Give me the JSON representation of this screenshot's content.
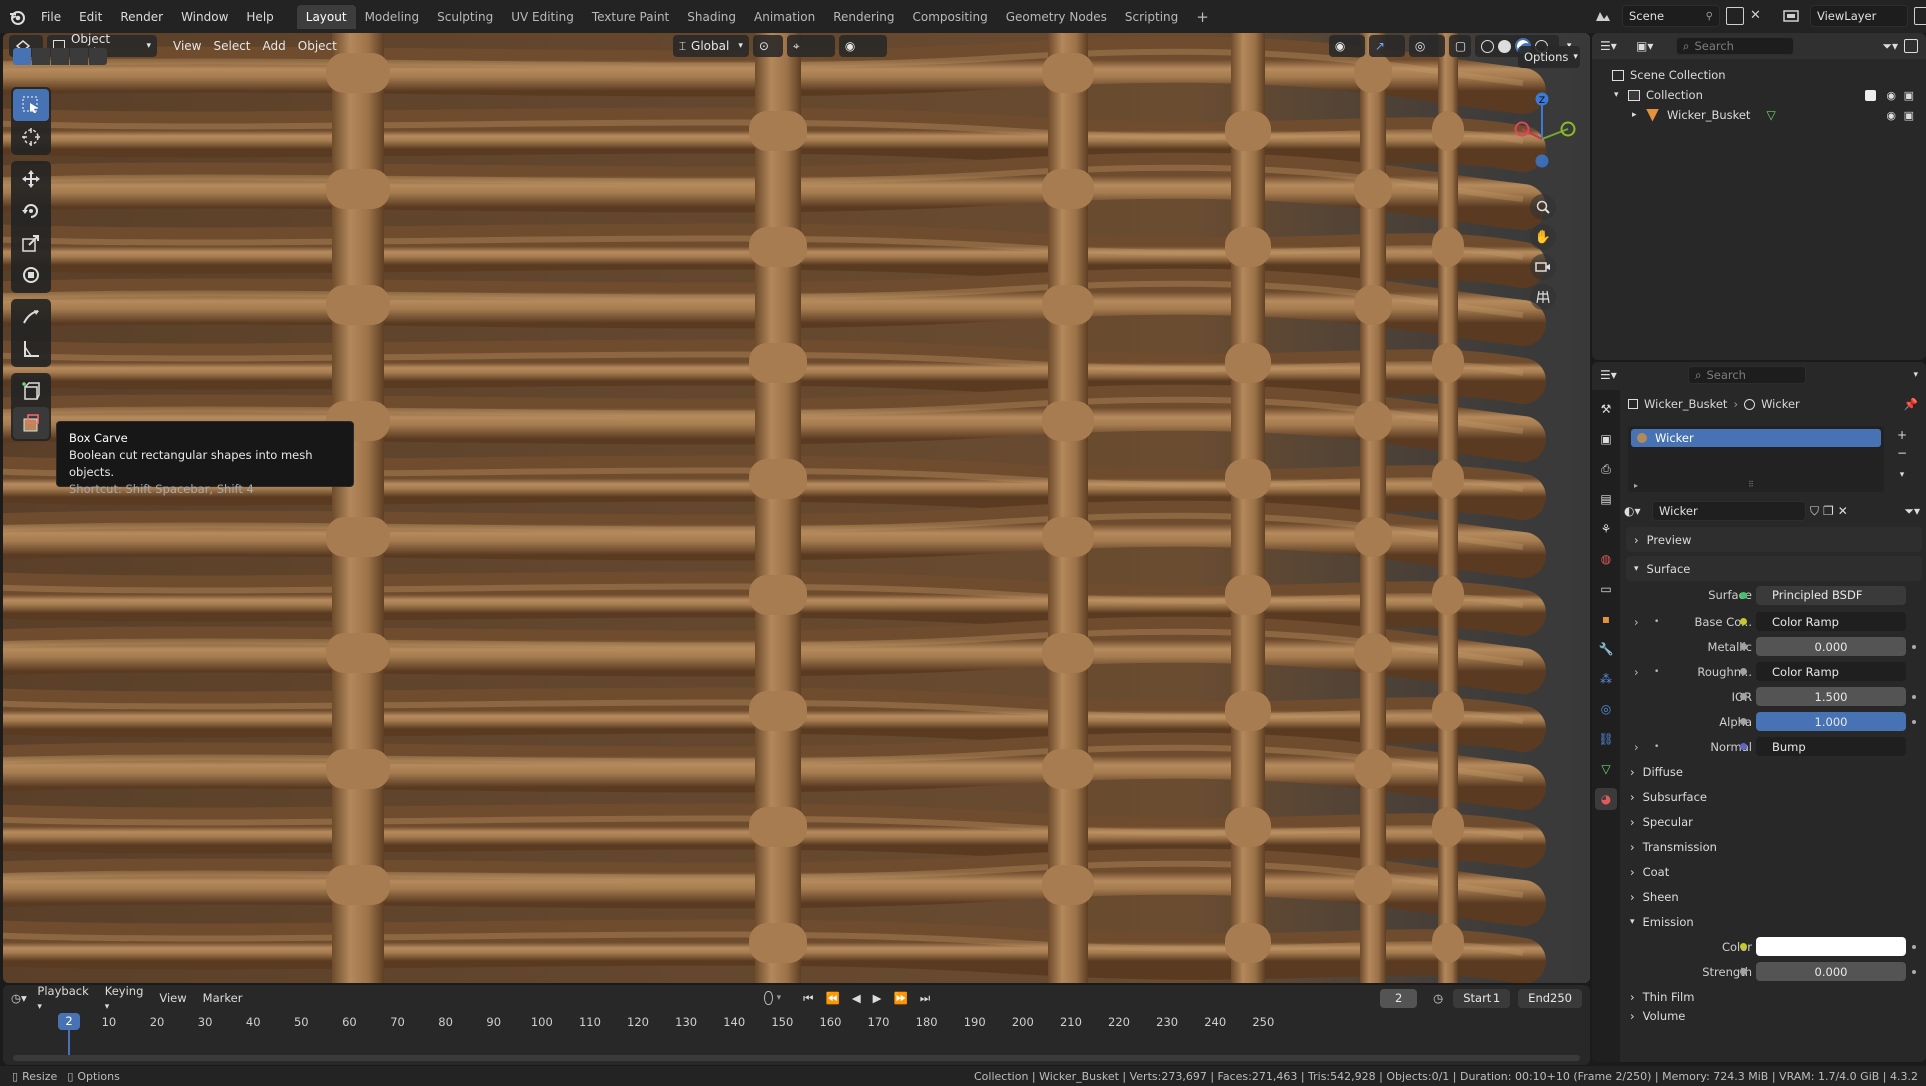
{
  "menu": [
    "File",
    "Edit",
    "Render",
    "Window",
    "Help"
  ],
  "workspaces": [
    "Layout",
    "Modeling",
    "Sculpting",
    "UV Editing",
    "Texture Paint",
    "Shading",
    "Animation",
    "Rendering",
    "Compositing",
    "Geometry Nodes",
    "Scripting"
  ],
  "active_workspace": "Layout",
  "scene": "Scene",
  "view_layer": "ViewLayer",
  "viewport": {
    "mode": "Object Mode",
    "menus": [
      "View",
      "Select",
      "Add",
      "Object"
    ],
    "orientation": "Global",
    "options_label": "Options",
    "gizmo_axes": {
      "z": "Z",
      "y": "Y",
      "x": "X"
    }
  },
  "tooltip": {
    "title": "Box Carve",
    "description": "Boolean cut rectangular shapes into mesh objects.",
    "shortcut": "Shortcut: Shift Spacebar, Shift 4"
  },
  "outliner": {
    "search_placeholder": "Search",
    "scene_collection": "Scene Collection",
    "collection": "Collection",
    "object": "Wicker_Busket"
  },
  "properties": {
    "search_placeholder": "Search",
    "breadcrumb_object": "Wicker_Busket",
    "breadcrumb_material": "Wicker",
    "slot_name": "Wicker",
    "material_name": "Wicker",
    "sections": {
      "preview": "Preview",
      "surface": "Surface"
    },
    "surface_shader_label": "Surface",
    "surface_shader": "Principled BSDF",
    "rows": [
      {
        "label": "Base Co...",
        "value": "Color Ramp",
        "kind": "link",
        "dot": "#c7c729",
        "expand": true
      },
      {
        "label": "Metallic",
        "value": "0.000",
        "kind": "num",
        "dot": "#a1a1a1"
      },
      {
        "label": "Roughn...",
        "value": "Color Ramp",
        "kind": "link",
        "dot": "#a1a1a1",
        "expand": true
      },
      {
        "label": "IOR",
        "value": "1.500",
        "kind": "num",
        "dot": "#a1a1a1"
      },
      {
        "label": "Alpha",
        "value": "1.000",
        "kind": "blue",
        "dot": "#a1a1a1"
      },
      {
        "label": "Normal",
        "value": "Bump",
        "kind": "link",
        "dot": "#6363c7",
        "expand": true
      }
    ],
    "subsections": [
      "Diffuse",
      "Subsurface",
      "Specular",
      "Transmission",
      "Coat",
      "Sheen"
    ],
    "emission": {
      "label": "Emission",
      "color_label": "Color",
      "color": "#ffffff",
      "strength_label": "Strength",
      "strength": "0.000"
    },
    "thin_film": "Thin Film",
    "volume": "Volume"
  },
  "timeline": {
    "menus": [
      "Playback",
      "Keying",
      "View",
      "Marker"
    ],
    "current_frame": "2",
    "start_label": "Start",
    "start": "1",
    "end_label": "End",
    "end": "250",
    "ticks": [
      "10",
      "20",
      "30",
      "40",
      "50",
      "60",
      "70",
      "80",
      "90",
      "100",
      "110",
      "120",
      "130",
      "140",
      "150",
      "160",
      "170",
      "180",
      "190",
      "200",
      "210",
      "220",
      "230",
      "240",
      "250"
    ]
  },
  "status": {
    "left_resize": "Resize",
    "left_options": "Options",
    "info": "Collection | Wicker_Busket | Verts:273,697 | Faces:271,463 | Tris:542,928 | Objects:0/1 | Duration: 00:10+10 (Frame 2/250) | Memory: 724.3 MiB | VRAM: 1.7/4.0 GiB | 4.3.2"
  },
  "colors": {
    "accent": "#4772b3",
    "wood": "#9a7048",
    "bg": "#282828"
  }
}
